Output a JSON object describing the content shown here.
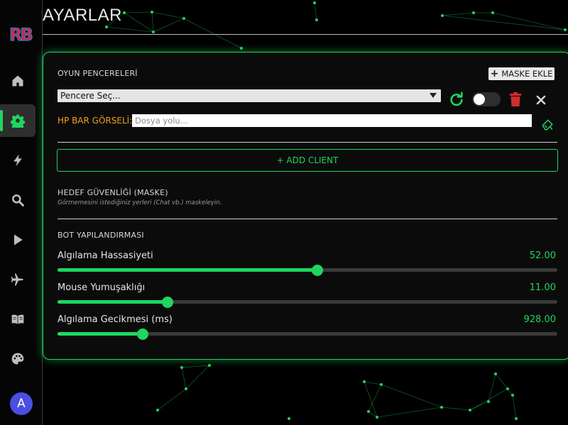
{
  "app": {
    "logo_text": "RB"
  },
  "page": {
    "title": "AYARLAR"
  },
  "sidebar": {
    "items": [
      {
        "icon": "home-icon",
        "active": false
      },
      {
        "icon": "gear-icon",
        "active": true
      },
      {
        "icon": "lightning-icon",
        "active": false
      },
      {
        "icon": "search-icon",
        "active": false
      },
      {
        "icon": "play-icon",
        "active": false
      },
      {
        "icon": "airplane-icon",
        "active": false
      },
      {
        "icon": "book-icon",
        "active": false
      },
      {
        "icon": "palette-icon",
        "active": false
      }
    ],
    "avatar_letter": "A"
  },
  "game_windows": {
    "label": "OYUN PENCERELERİ",
    "add_mask_label": "MASKE EKLE",
    "select_value": "Pencere Seç...",
    "toggle_on": false
  },
  "hp_bar": {
    "label": "HP BAR GÖRSELİ:",
    "placeholder": "Dosya yolu..."
  },
  "add_client_label": "+ ADD CLIENT",
  "target_security": {
    "label": "HEDEF GÜVENLİĞİ (MASKE)",
    "hint": "Görmemesini istediğiniz yerleri (Chat vb.) maskeleyin."
  },
  "bot_config": {
    "label": "BOT YAPILANDIRMASI",
    "sliders": [
      {
        "label": "Algılama Hassasiyeti",
        "value": "52.00",
        "fraction": 0.52
      },
      {
        "label": "Mouse Yumuşaklığı",
        "value": "11.00",
        "fraction": 0.22
      },
      {
        "label": "Algılama Gecikmesi (ms)",
        "value": "928.00",
        "fraction": 0.17
      }
    ]
  },
  "colors": {
    "accent": "#1fd65f",
    "warning": "#f0a020",
    "danger": "#d12c2c",
    "avatar": "#4b4fe0"
  }
}
